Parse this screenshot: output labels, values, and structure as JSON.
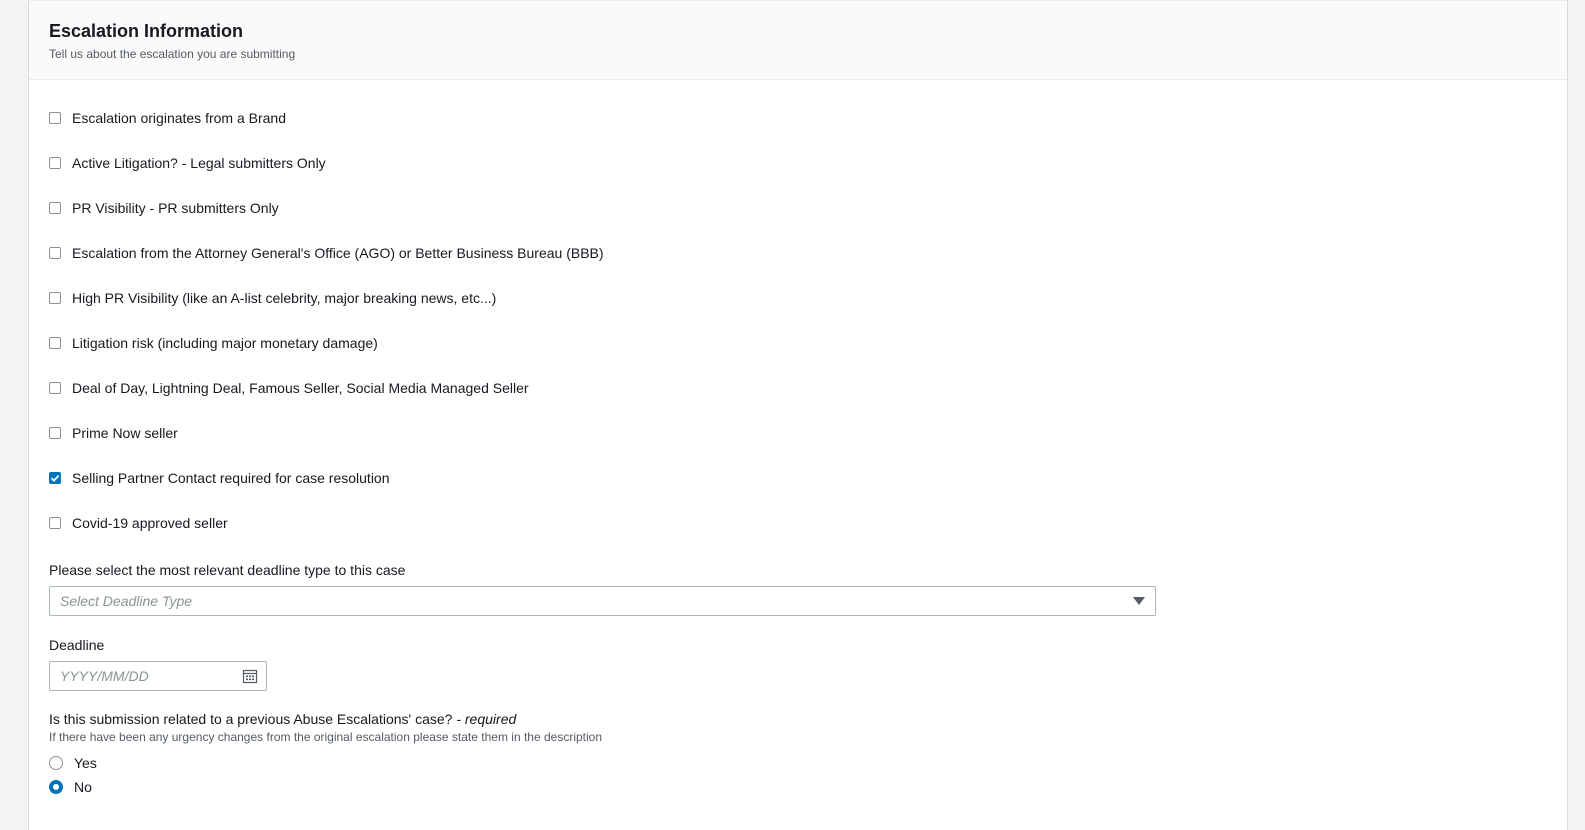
{
  "panel": {
    "title": "Escalation Information",
    "description": "Tell us about the escalation you are submitting"
  },
  "checkboxes": [
    {
      "label": "Escalation originates from a Brand",
      "checked": false
    },
    {
      "label": "Active Litigation? - Legal submitters Only",
      "checked": false
    },
    {
      "label": "PR Visibility - PR submitters Only",
      "checked": false
    },
    {
      "label": "Escalation from the Attorney General's Office (AGO) or Better Business Bureau (BBB)",
      "checked": false
    },
    {
      "label": "High PR Visibility (like an A-list celebrity, major breaking news, etc...)",
      "checked": false
    },
    {
      "label": "Litigation risk (including major monetary damage)",
      "checked": false
    },
    {
      "label": "Deal of Day, Lightning Deal, Famous Seller, Social Media Managed Seller",
      "checked": false
    },
    {
      "label": "Prime Now seller",
      "checked": false
    },
    {
      "label": "Selling Partner Contact required for case resolution",
      "checked": true
    },
    {
      "label": "Covid-19 approved seller",
      "checked": false
    }
  ],
  "deadline_type": {
    "label": "Please select the most relevant deadline type to this case",
    "placeholder": "Select Deadline Type",
    "value": ""
  },
  "deadline": {
    "label": "Deadline",
    "placeholder": "YYYY/MM/DD",
    "value": ""
  },
  "previous_case": {
    "question": "Is this submission related to a previous Abuse Escalations' case?",
    "required_text": "- required",
    "hint": "If there have been any urgency changes from the original escalation please state them in the description",
    "options": [
      {
        "label": "Yes",
        "selected": false
      },
      {
        "label": "No",
        "selected": true
      }
    ]
  },
  "colors": {
    "accent": "#0073bb",
    "border": "#aab7b8",
    "text": "#16191f",
    "muted": "#545b64",
    "placeholder": "#879596"
  },
  "icons": {
    "select_caret": "caret-down-icon",
    "date_picker": "calendar-icon",
    "checked_mark": "checkmark-icon"
  }
}
